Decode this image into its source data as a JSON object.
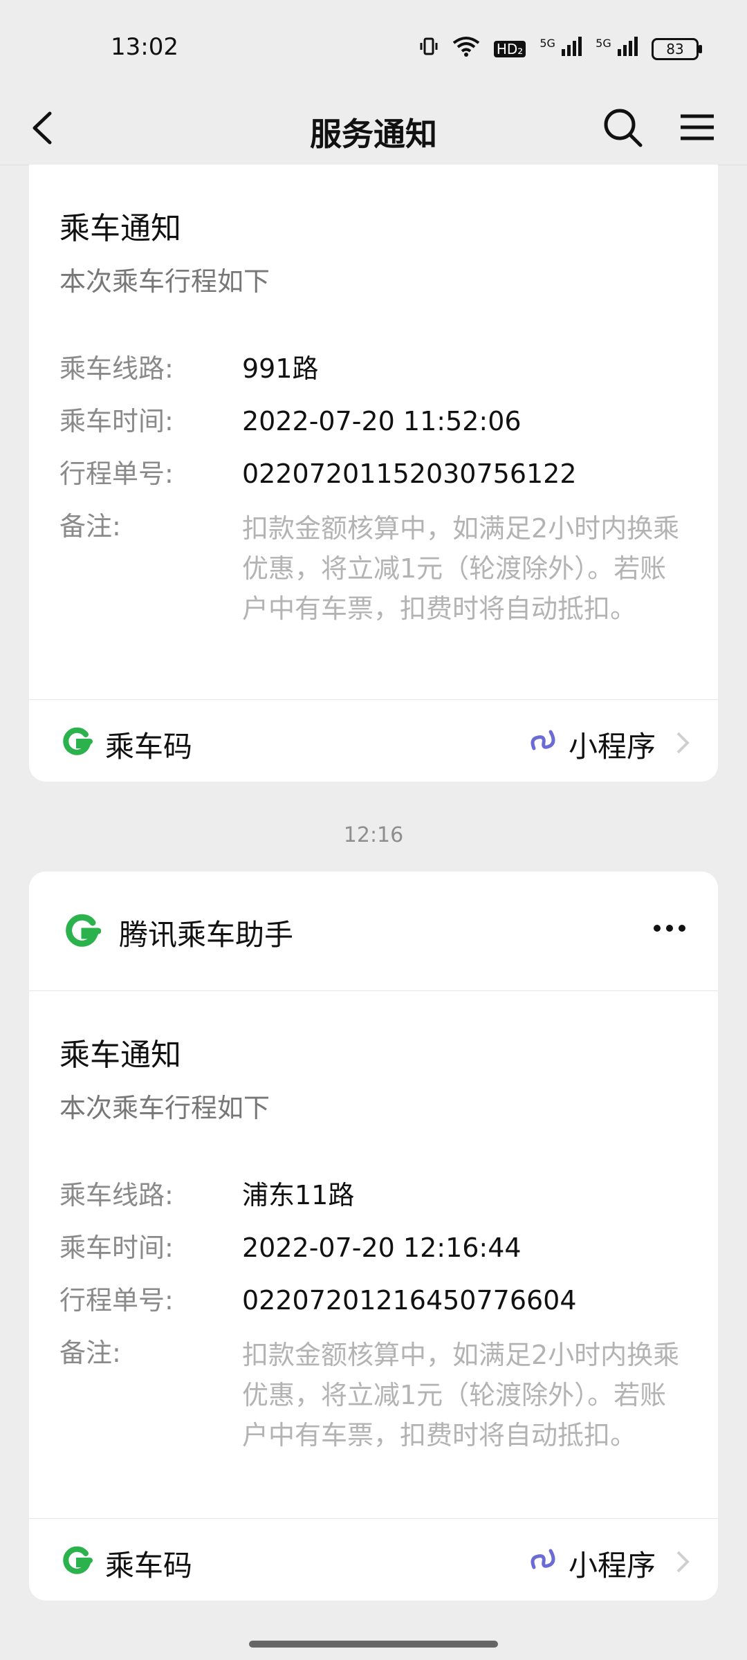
{
  "status_bar": {
    "time": "13:02",
    "icons": [
      "vibrate-icon",
      "wifi-icon",
      "hd-icon",
      "signal-5g-icon",
      "signal-5g-icon"
    ],
    "hd_label": "HD₂",
    "net1": "5G",
    "net2": "5G",
    "battery": "83"
  },
  "nav": {
    "title": "服务通知"
  },
  "brand": {
    "name": "腾讯乘车助手",
    "color": "#2bb24c"
  },
  "timestamp": "12:16",
  "cards": [
    {
      "title": "乘车通知",
      "subtitle": "本次乘车行程如下",
      "rows": [
        {
          "label": "乘车线路:",
          "value": "991路"
        },
        {
          "label": "乘车时间:",
          "value": "2022-07-20 11:52:06"
        },
        {
          "label": "行程单号:",
          "value": "02207201152030756122"
        },
        {
          "label": "备注:",
          "value": "扣款金额核算中，如满足2小时内换乘优惠，将立减1元（轮渡除外）。若账户中有车票，扣费时将自动抵扣。"
        }
      ],
      "footer": {
        "left": "乘车码",
        "right": "小程序"
      }
    },
    {
      "title": "乘车通知",
      "subtitle": "本次乘车行程如下",
      "rows": [
        {
          "label": "乘车线路:",
          "value": "浦东11路"
        },
        {
          "label": "乘车时间:",
          "value": "2022-07-20 12:16:44"
        },
        {
          "label": "行程单号:",
          "value": "02207201216450776604"
        },
        {
          "label": "备注:",
          "value": "扣款金额核算中，如满足2小时内换乘优惠，将立减1元（轮渡除外）。若账户中有车票，扣费时将自动抵扣。"
        }
      ],
      "footer": {
        "left": "乘车码",
        "right": "小程序"
      }
    }
  ]
}
